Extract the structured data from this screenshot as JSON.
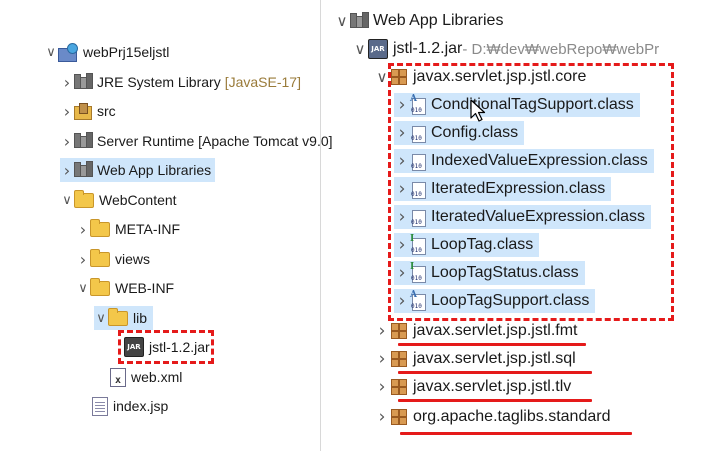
{
  "left_tree": {
    "items": [
      {
        "label": "webPrj15eljstl",
        "decor": "",
        "icon": "project-icon"
      },
      {
        "label": "JRE System Library",
        "decor": "[JavaSE-17]",
        "icon": "library-icon"
      },
      {
        "label": "src",
        "decor": "",
        "icon": "source-folder-icon"
      },
      {
        "label": "Server Runtime [Apache Tomcat v9.0]",
        "decor": "",
        "icon": "library-icon"
      },
      {
        "label": "Web App Libraries",
        "decor": "",
        "icon": "library-icon"
      },
      {
        "label": "WebContent",
        "decor": "",
        "icon": "folder-icon"
      },
      {
        "label": "META-INF",
        "decor": "",
        "icon": "folder-icon"
      },
      {
        "label": "views",
        "decor": "",
        "icon": "folder-icon"
      },
      {
        "label": "WEB-INF",
        "decor": "",
        "icon": "folder-icon"
      },
      {
        "label": "lib",
        "decor": "",
        "icon": "folder-icon"
      },
      {
        "label": "jstl-1.2.jar",
        "decor": "",
        "icon": "jar-icon"
      },
      {
        "label": "web.xml",
        "decor": "",
        "icon": "xml-file-icon"
      },
      {
        "label": "index.jsp",
        "decor": "",
        "icon": "jsp-file-icon"
      }
    ]
  },
  "right_tree": {
    "root": {
      "label": "Web App Libraries",
      "icon": "library-icon"
    },
    "jar": {
      "label": "jstl-1.2.jar",
      "path": " - D:₩dev₩webRepo₩webPr",
      "icon": "jar-icon"
    },
    "core_package": {
      "label": "javax.servlet.jsp.jstl.core",
      "icon": "package-icon"
    },
    "classes": [
      {
        "label": "ConditionalTagSupport.class",
        "icon": "abstract-class-file-icon"
      },
      {
        "label": "Config.class",
        "icon": "class-file-icon"
      },
      {
        "label": "IndexedValueExpression.class",
        "icon": "class-file-icon"
      },
      {
        "label": "IteratedExpression.class",
        "icon": "class-file-icon"
      },
      {
        "label": "IteratedValueExpression.class",
        "icon": "class-file-icon"
      },
      {
        "label": "LoopTag.class",
        "icon": "interface-file-icon"
      },
      {
        "label": "LoopTagStatus.class",
        "icon": "interface-file-icon"
      },
      {
        "label": "LoopTagSupport.class",
        "icon": "abstract-class-file-icon"
      }
    ],
    "other_packages": [
      {
        "label": "javax.servlet.jsp.jstl.fmt",
        "icon": "package-icon"
      },
      {
        "label": "javax.servlet.jsp.jstl.sql",
        "icon": "package-icon"
      },
      {
        "label": "javax.servlet.jsp.jstl.tlv",
        "icon": "package-icon"
      },
      {
        "label": "org.apache.taglibs.standard",
        "icon": "package-icon"
      }
    ]
  },
  "colors": {
    "annotation": "#e51a1a",
    "selection": "#cfe6fb",
    "decoration": "#9a7b3a",
    "path": "#8a8a8a"
  },
  "glyphs": {
    "expanded": "∨",
    "collapsed": "›"
  }
}
